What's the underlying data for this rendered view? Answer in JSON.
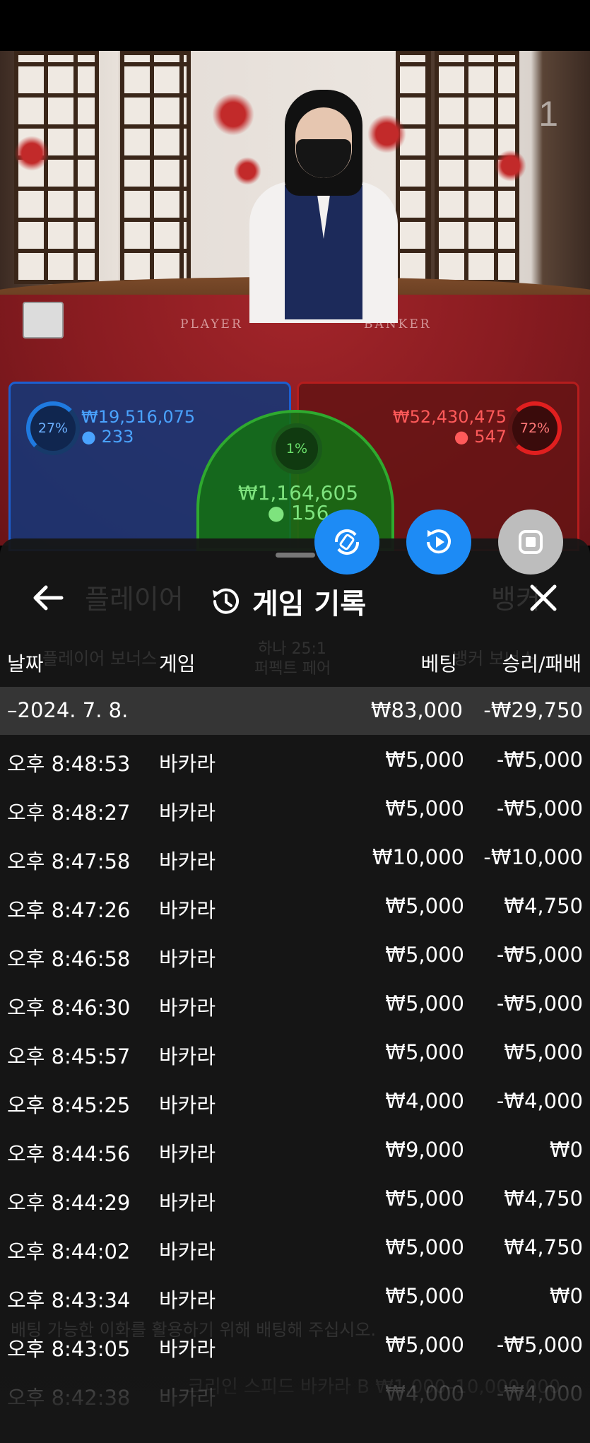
{
  "video": {
    "counter": "1",
    "felt_player": "PLAYER",
    "felt_banker": "BANKER"
  },
  "bets": {
    "player": {
      "percent": "27%",
      "amount": "₩19,516,075",
      "players": "233"
    },
    "banker": {
      "percent": "72%",
      "amount": "₩52,430,475",
      "players": "547"
    },
    "tie": {
      "percent": "1%",
      "amount": "₩1,164,605",
      "players": "156"
    }
  },
  "fabs": {
    "rotate_icon": "rotate-icon",
    "replay_icon": "replay-icon",
    "stop_icon": "stop-icon"
  },
  "history": {
    "title": "게임 기록",
    "columns": {
      "date": "날짜",
      "game": "게임",
      "bet": "베팅",
      "winloss": "승리/패배"
    },
    "summary": {
      "date": "–2024. 7. 8.",
      "bet": "₩83,000",
      "winloss": "-₩29,750"
    },
    "rows": [
      {
        "time": "오후 8:48:53",
        "game": "바카라",
        "bet": "₩5,000",
        "winloss": "-₩5,000"
      },
      {
        "time": "오후 8:48:27",
        "game": "바카라",
        "bet": "₩5,000",
        "winloss": "-₩5,000"
      },
      {
        "time": "오후 8:47:58",
        "game": "바카라",
        "bet": "₩10,000",
        "winloss": "-₩10,000"
      },
      {
        "time": "오후 8:47:26",
        "game": "바카라",
        "bet": "₩5,000",
        "winloss": "₩4,750"
      },
      {
        "time": "오후 8:46:58",
        "game": "바카라",
        "bet": "₩5,000",
        "winloss": "-₩5,000"
      },
      {
        "time": "오후 8:46:30",
        "game": "바카라",
        "bet": "₩5,000",
        "winloss": "-₩5,000"
      },
      {
        "time": "오후 8:45:57",
        "game": "바카라",
        "bet": "₩5,000",
        "winloss": "₩5,000"
      },
      {
        "time": "오후 8:45:25",
        "game": "바카라",
        "bet": "₩4,000",
        "winloss": "-₩4,000"
      },
      {
        "time": "오후 8:44:56",
        "game": "바카라",
        "bet": "₩9,000",
        "winloss": "₩0"
      },
      {
        "time": "오후 8:44:29",
        "game": "바카라",
        "bet": "₩5,000",
        "winloss": "₩4,750"
      },
      {
        "time": "오후 8:44:02",
        "game": "바카라",
        "bet": "₩5,000",
        "winloss": "₩4,750"
      },
      {
        "time": "오후 8:43:34",
        "game": "바카라",
        "bet": "₩5,000",
        "winloss": "₩0"
      },
      {
        "time": "오후 8:43:05",
        "game": "바카라",
        "bet": "₩5,000",
        "winloss": "-₩5,000"
      },
      {
        "time": "오후 8:42:38",
        "game": "바카라",
        "bet": "₩4,000",
        "winloss": "-₩4,000"
      }
    ]
  },
  "background_ghost": {
    "tab_left": "플레이어",
    "tab_right": "뱅커",
    "side_bet_1": "플레이어 보너스",
    "side_bet_2": "하나 25:1",
    "side_bet_2b": "퍼펙트 페어",
    "side_bet_3": "뱅커 보너스",
    "notice": "배팅 가능한 이화를 활용하기 위해 배팅해 주십시오.",
    "footer": "크리인 스피드 바카라 B ₩1,000–10,000,000"
  },
  "colors": {
    "blue": "#1d8bf5",
    "sheet": "#161616",
    "player": "#1c5fd0",
    "banker": "#b51d1d",
    "tie": "#2faa2f"
  }
}
